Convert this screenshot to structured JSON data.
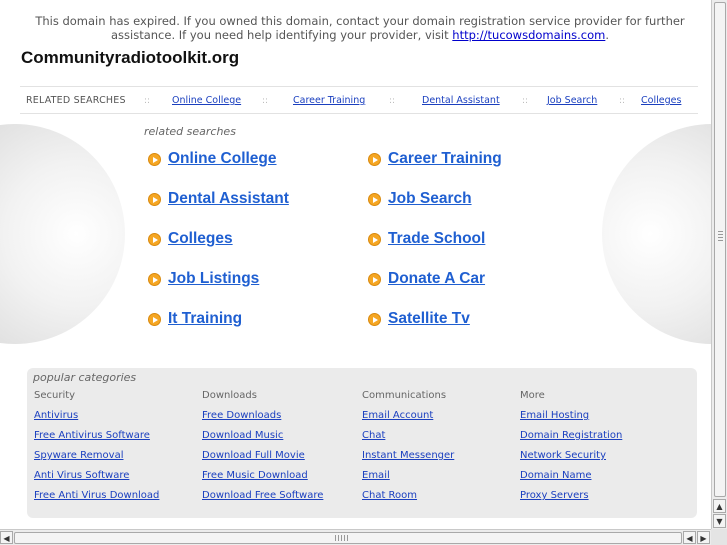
{
  "notice": {
    "text": "This domain has expired. If you owned this domain, contact your domain registration service provider for further assistance. If you need help identifying your provider, visit ",
    "link": "http://tucowsdomains.com",
    "end": "."
  },
  "site": {
    "title": "Communityradiotoolkit.org"
  },
  "related_bar": {
    "label": "RELATED SEARCHES",
    "separator": "::",
    "links": [
      "Online College",
      "Career Training",
      "Dental Assistant",
      "Job Search",
      "Colleges"
    ]
  },
  "related_searches": {
    "heading": "related searches",
    "left": [
      "Online College",
      "Dental Assistant",
      "Colleges",
      "Job Listings",
      "It Training"
    ],
    "right": [
      "Career Training",
      "Job Search",
      "Trade School",
      "Donate A Car",
      "Satellite Tv"
    ]
  },
  "popular": {
    "heading": "popular categories",
    "columns": [
      {
        "title": "Security",
        "links": [
          "Antivirus",
          "Free Antivirus Software",
          "Spyware Removal",
          "Anti Virus Software",
          "Free Anti Virus Download"
        ]
      },
      {
        "title": "Downloads",
        "links": [
          "Free Downloads",
          "Download Music",
          "Download Full Movie",
          "Free Music Download",
          "Download Free Software"
        ]
      },
      {
        "title": "Communications",
        "links": [
          "Email Account",
          "Chat",
          "Instant Messenger",
          "Email",
          "Chat Room"
        ]
      },
      {
        "title": "More",
        "links": [
          "Email Hosting",
          "Domain Registration",
          "Network Security",
          "Domain Name",
          "Proxy Servers"
        ]
      }
    ]
  },
  "icons": {
    "arrow": "arrow-right-circle-icon"
  },
  "colors": {
    "link": "#1f5fd1",
    "arrow": "#f5a623",
    "panel": "#ebebeb"
  }
}
